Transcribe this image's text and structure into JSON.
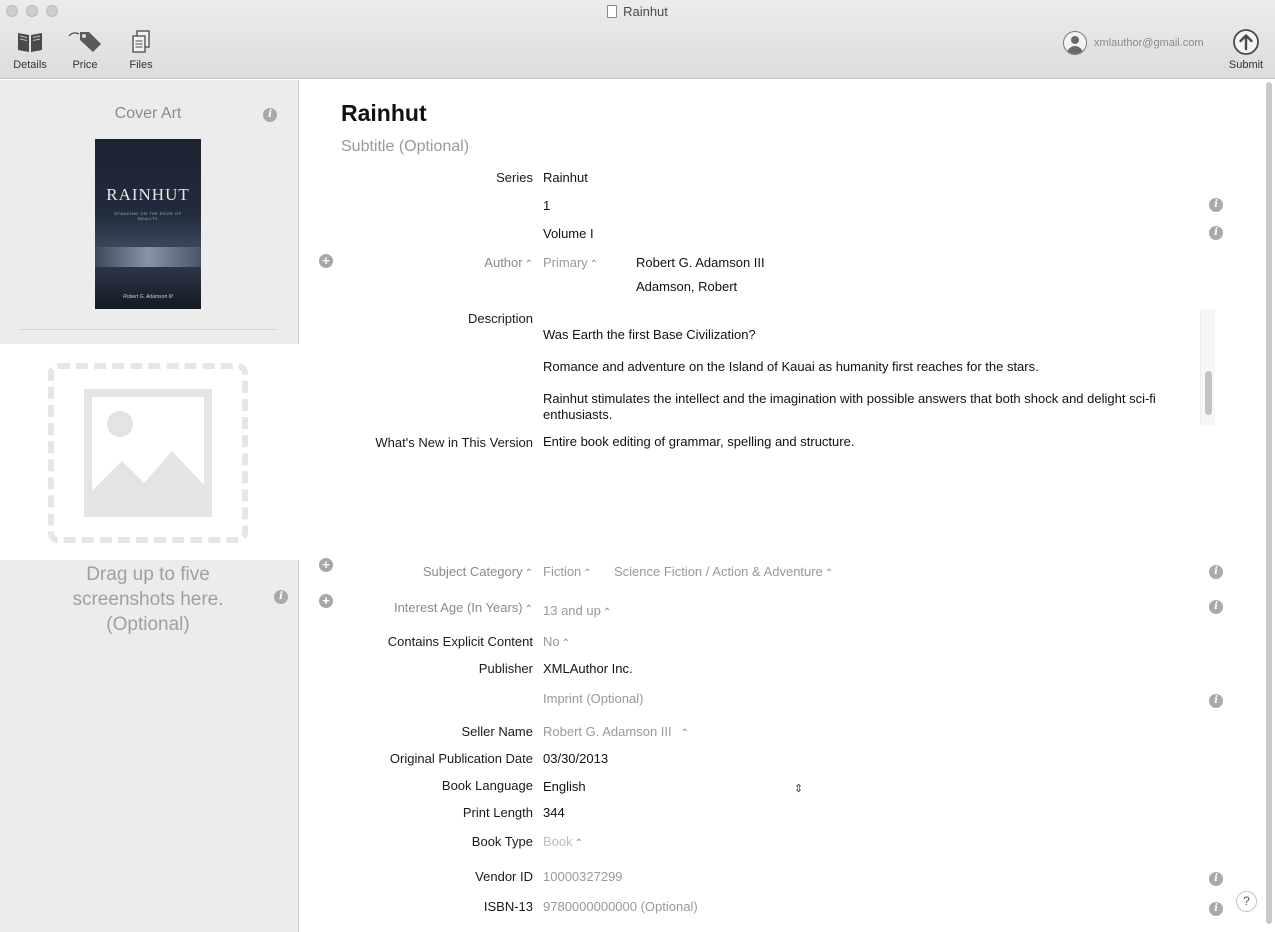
{
  "window": {
    "title": "Rainhut"
  },
  "toolbar": {
    "details_label": "Details",
    "price_label": "Price",
    "files_label": "Files",
    "submit_label": "Submit",
    "account_email": "xmlauthor@gmail.com"
  },
  "sidebar": {
    "cover_art_label": "Cover Art",
    "cover": {
      "title": "RAINHUT",
      "subtitle": "STANDING ON THE EDGE OF REALITY",
      "author": "Robert G. Adamson III"
    },
    "screenshots_hint": "Drag up to five screenshots here. (Optional)"
  },
  "book": {
    "title": "Rainhut",
    "subtitle_placeholder": "Subtitle (Optional)"
  },
  "fields": {
    "series": {
      "label": "Series",
      "name": "Rainhut",
      "number": "1",
      "volume": "Volume I"
    },
    "author": {
      "label": "Author",
      "role": "Primary",
      "name": "Robert G. Adamson III",
      "sort_name": "Adamson, Robert"
    },
    "description": {
      "label": "Description",
      "paragraphs": [
        "Was Earth the first Base Civilization?",
        "Romance and adventure on the Island of Kauai as humanity first reaches for the stars.",
        "Rainhut stimulates the intellect and the imagination with possible answers that both shock and delight sci-fi enthusiasts."
      ]
    },
    "whats_new": {
      "label": "What's New in This Version",
      "value": "Entire book editing of grammar, spelling and structure."
    },
    "subject_category": {
      "label": "Subject Category",
      "value": "Fiction",
      "subcategory": "Science Fiction / Action & Adventure"
    },
    "interest_age": {
      "label": "Interest Age (In Years)",
      "value": "13 and up"
    },
    "explicit": {
      "label": "Contains Explicit Content",
      "value": "No"
    },
    "publisher": {
      "label": "Publisher",
      "value": "XMLAuthor Inc.",
      "imprint_placeholder": "Imprint (Optional)"
    },
    "seller_name": {
      "label": "Seller Name",
      "value": "Robert G. Adamson III"
    },
    "pub_date": {
      "label": "Original Publication Date",
      "value": "03/30/2013"
    },
    "language": {
      "label": "Book Language",
      "value": "English"
    },
    "print_length": {
      "label": "Print Length",
      "value": "344"
    },
    "book_type": {
      "label": "Book Type",
      "value": "Book"
    },
    "vendor_id": {
      "label": "Vendor ID",
      "value": "10000327299"
    },
    "isbn": {
      "label": "ISBN-13",
      "value": "9780000000000 (Optional)"
    }
  },
  "help": {
    "label": "?"
  },
  "colors": {
    "accent": "#111111",
    "label_dim": "#8a8a8a",
    "sidebar_bg": "#ececec"
  }
}
